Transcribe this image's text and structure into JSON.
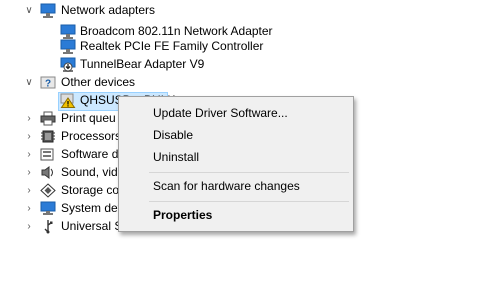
{
  "tree": {
    "network_adapters": {
      "label": "Network adapters",
      "children": [
        "Broadcom 802.11n Network Adapter",
        "Realtek PCIe FE Family Controller",
        "TunnelBear Adapter V9"
      ]
    },
    "other_devices": {
      "label": "Other devices",
      "child": "QHSUSB__BULK"
    },
    "print_queues": "Print queu",
    "processors": "Processors",
    "software_devices": "Software d",
    "sound": "Sound, vid",
    "storage": "Storage co",
    "system_devices": "System dev",
    "usb": "Universal Serial Bus controllers"
  },
  "context_menu": {
    "items": [
      "Update Driver Software...",
      "Disable",
      "Uninstall",
      "Scan for hardware changes",
      "Properties"
    ]
  },
  "colors": {
    "selection": "#cce8ff",
    "menu_bg": "#f0f0f0",
    "warning": "#f2c200"
  }
}
